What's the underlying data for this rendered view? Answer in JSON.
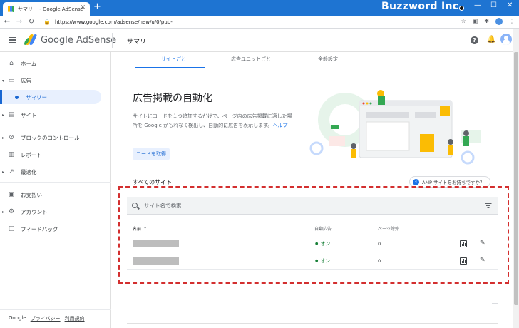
{
  "browser": {
    "tab_title": "サマリー - Google AdSense",
    "url": "https://www.google.com/adsense/new/u/0/pub-",
    "brand": "Buzzword Inc."
  },
  "header": {
    "product": "Google AdSense",
    "page_title": "サマリー"
  },
  "sidebar": {
    "items": [
      {
        "label": "ホーム",
        "icon": "home-icon"
      },
      {
        "label": "広告",
        "icon": "ads-icon"
      },
      {
        "label": "サマリー",
        "icon": "bullet"
      },
      {
        "label": "サイト",
        "icon": "sites-icon"
      },
      {
        "label": "ブロックのコントロール",
        "icon": "block-icon"
      },
      {
        "label": "レポート",
        "icon": "report-icon"
      },
      {
        "label": "最適化",
        "icon": "trend-icon"
      },
      {
        "label": "お支払い",
        "icon": "payments-icon"
      },
      {
        "label": "アカウント",
        "icon": "gear-icon"
      },
      {
        "label": "フィードバック",
        "icon": "feedback-icon"
      }
    ],
    "footer": {
      "google": "Google",
      "privacy": "プライバシー",
      "terms": "利用規約"
    }
  },
  "main": {
    "tabs": [
      "サイトごと",
      "広告ユニットごと",
      "全般設定"
    ],
    "hero": {
      "title": "広告掲載の自動化",
      "desc": "サイトにコードを１つ追加するだけで、ページ内の広告掲載に適した場所を Google がもれなく検出し、自動的に広告を表示します。",
      "help": "ヘルプ",
      "button": "コードを取得"
    },
    "all_sites": "すべてのサイト",
    "amp_chip": "AMP サイトをお持ちですか？",
    "search_placeholder": "サイト名で検索",
    "table": {
      "columns": [
        "名前",
        "自動広告",
        "ページ除外"
      ],
      "rows": [
        {
          "status": "オン",
          "excluded": "0"
        },
        {
          "status": "オン",
          "excluded": "0"
        }
      ]
    }
  },
  "colors": {
    "chrome_blue": "#1e74d2",
    "accent": "#1a73e8",
    "status_on": "#188038",
    "highlight_border": "#d32f2f"
  }
}
